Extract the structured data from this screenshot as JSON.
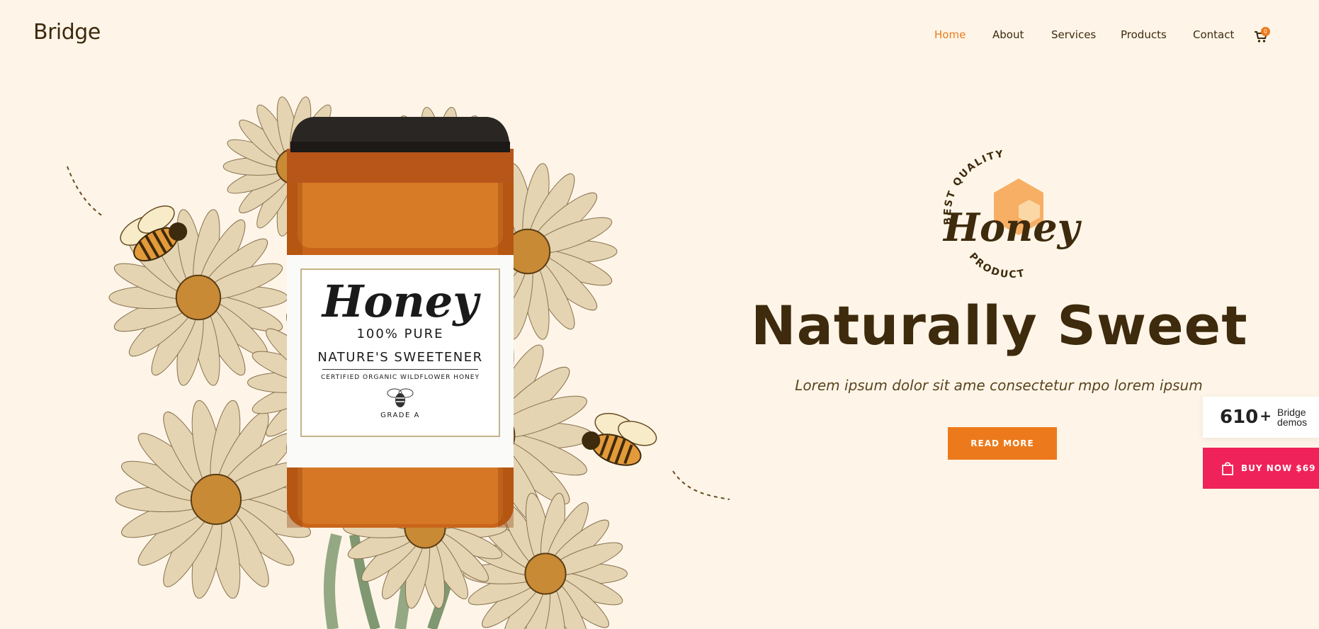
{
  "brand": {
    "name": "Bridge"
  },
  "nav": {
    "items": [
      {
        "label": "Home",
        "active": true
      },
      {
        "label": "About"
      },
      {
        "label": "Services"
      },
      {
        "label": "Products"
      },
      {
        "label": "Contact"
      }
    ],
    "cart": {
      "icon": "cart-icon",
      "count": "0"
    }
  },
  "product": {
    "label_script": "Honey",
    "label_pure": "100% PURE",
    "label_sweetener": "NATURE'S SWEETENER",
    "label_organic": "CERTIFIED ORGANIC WILDFLOWER HONEY",
    "label_grade": "GRADE A"
  },
  "badge": {
    "top": "BEST QUALITY",
    "script": "Honey",
    "bottom": "PRODUCT"
  },
  "hero": {
    "title": "Naturally Sweet",
    "subtitle": "Lorem ipsum dolor sit ame consectetur mpo lorem ipsum",
    "cta": "READ MORE"
  },
  "widgets": {
    "demos_count": "610",
    "demos_plus": "+",
    "demos_line1": "Bridge",
    "demos_line2": "demos",
    "buy_label": "BUY NOW $69",
    "buy_icon": "shopping-bag-icon"
  },
  "colors": {
    "accent": "#ec7a1c",
    "text": "#3e2a0c",
    "background": "#fef5e8",
    "buy": "#ef2359"
  }
}
